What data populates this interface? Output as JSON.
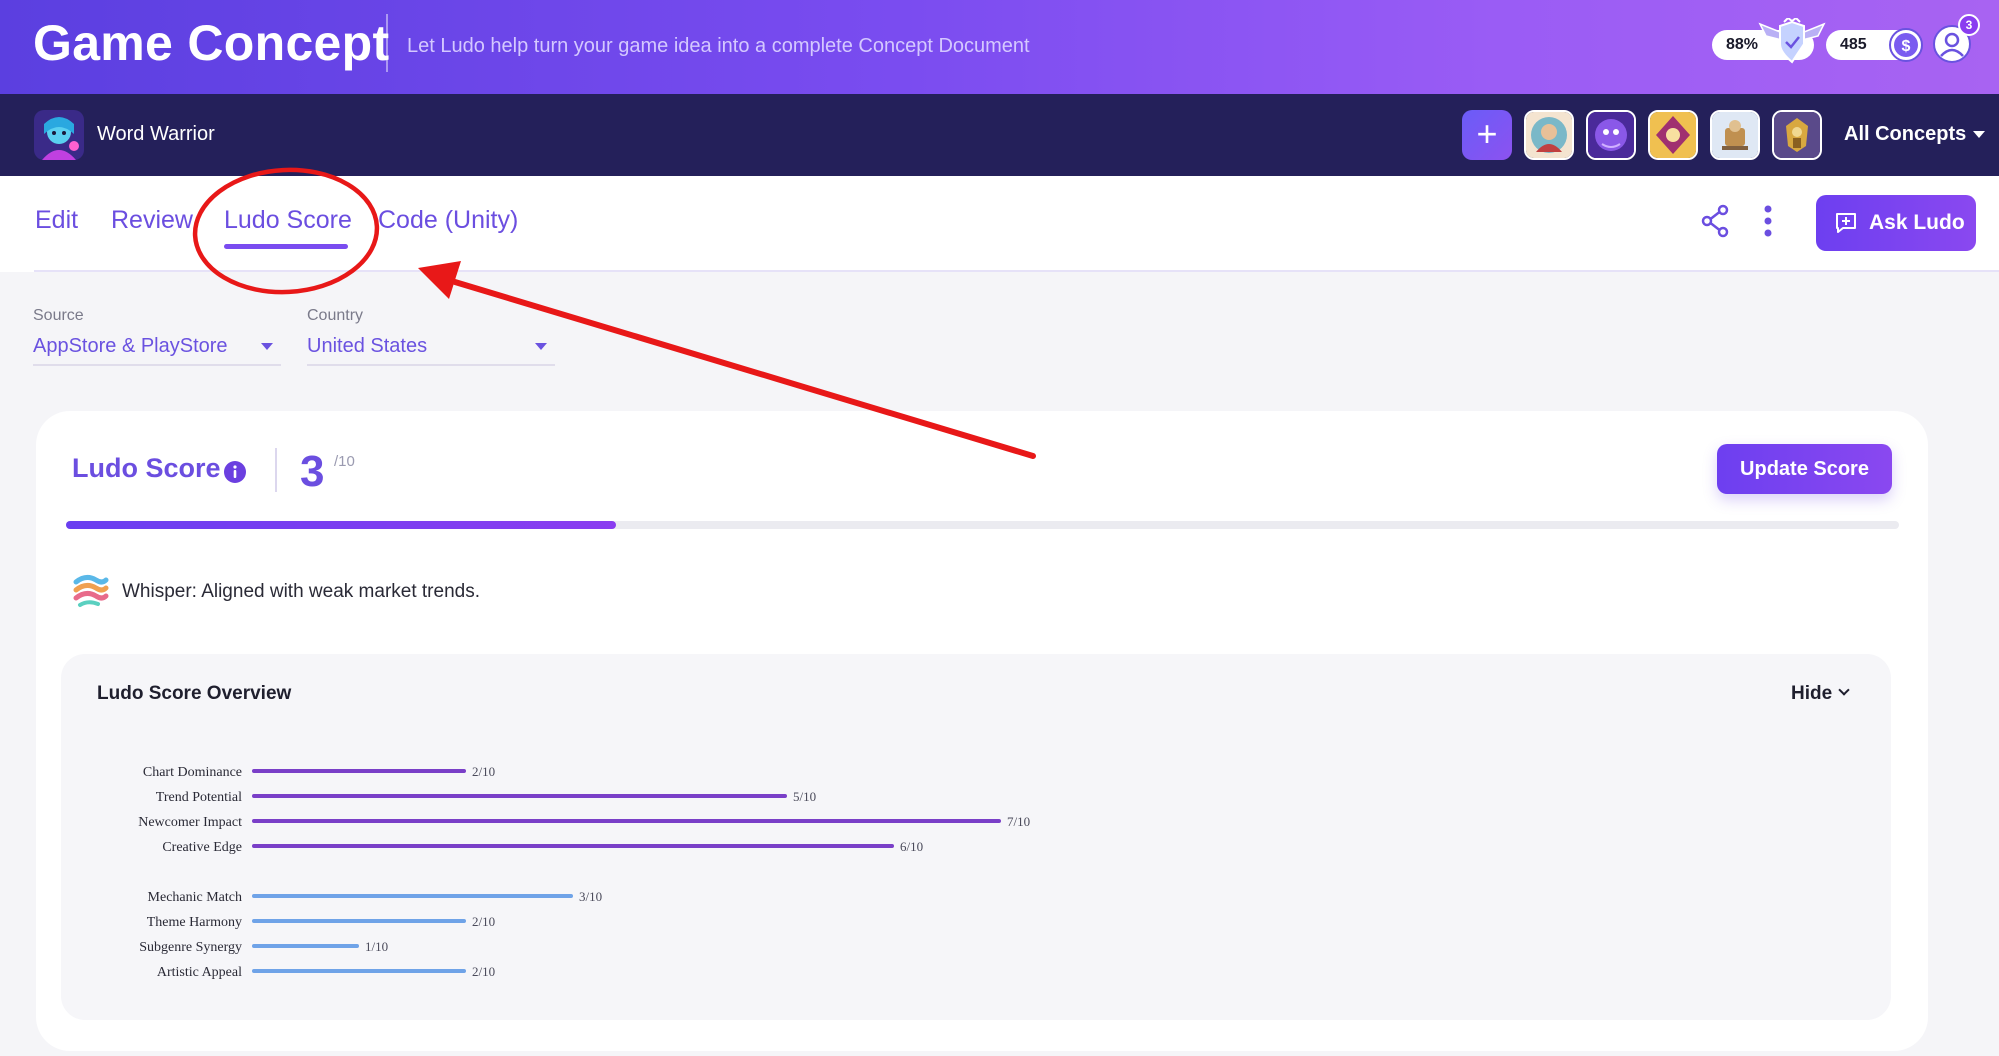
{
  "header": {
    "title": "Game Concept",
    "subtitle": "Let Ludo help turn your game idea into a complete Concept Document",
    "progress": "88%",
    "coins": "485",
    "notifications": "3"
  },
  "project": {
    "name": "Word Warrior",
    "all_concepts_label": "All Concepts",
    "add_icon": "plus-icon",
    "concept_thumbnails": [
      "concept-thumb-1",
      "concept-thumb-2",
      "concept-thumb-3",
      "concept-thumb-4",
      "concept-thumb-5"
    ]
  },
  "tabs": [
    {
      "label": "Edit"
    },
    {
      "label": "Review"
    },
    {
      "label": "Ludo Score",
      "active": true
    },
    {
      "label": "Code (Unity)"
    }
  ],
  "actions": {
    "ask_label": "Ask Ludo",
    "share_icon": "share-icon",
    "more_icon": "more-vertical-icon"
  },
  "filters": {
    "source_label": "Source",
    "source_value": "AppStore & PlayStore",
    "country_label": "Country",
    "country_value": "United States"
  },
  "score": {
    "title": "Ludo Score",
    "value": "3",
    "max": "/10",
    "fraction": 0.3,
    "update_label": "Update Score"
  },
  "whisper": {
    "text": "Whisper: Aligned with weak market trends."
  },
  "overview": {
    "title": "Ludo Score Overview",
    "hide_label": "Hide"
  },
  "colors": {
    "accent": "#6b4ee0",
    "bar_purple": "#7a3fc8",
    "bar_blue": "#6fa3e8",
    "annotation": "#e81818"
  },
  "chart_data": {
    "type": "bar",
    "orientation": "horizontal",
    "max": 10,
    "groups": [
      {
        "color": "#7a3fc8",
        "items": [
          {
            "label": "Chart Dominance",
            "value": 2,
            "text": "2/10"
          },
          {
            "label": "Trend Potential",
            "value": 5,
            "text": "5/10"
          },
          {
            "label": "Newcomer Impact",
            "value": 7,
            "text": "7/10"
          },
          {
            "label": "Creative Edge",
            "value": 6,
            "text": "6/10"
          }
        ]
      },
      {
        "color": "#6fa3e8",
        "items": [
          {
            "label": "Mechanic Match",
            "value": 3,
            "text": "3/10"
          },
          {
            "label": "Theme Harmony",
            "value": 2,
            "text": "2/10"
          },
          {
            "label": "Subgenre Synergy",
            "value": 1,
            "text": "1/10"
          },
          {
            "label": "Artistic Appeal",
            "value": 2,
            "text": "2/10"
          }
        ]
      }
    ]
  }
}
